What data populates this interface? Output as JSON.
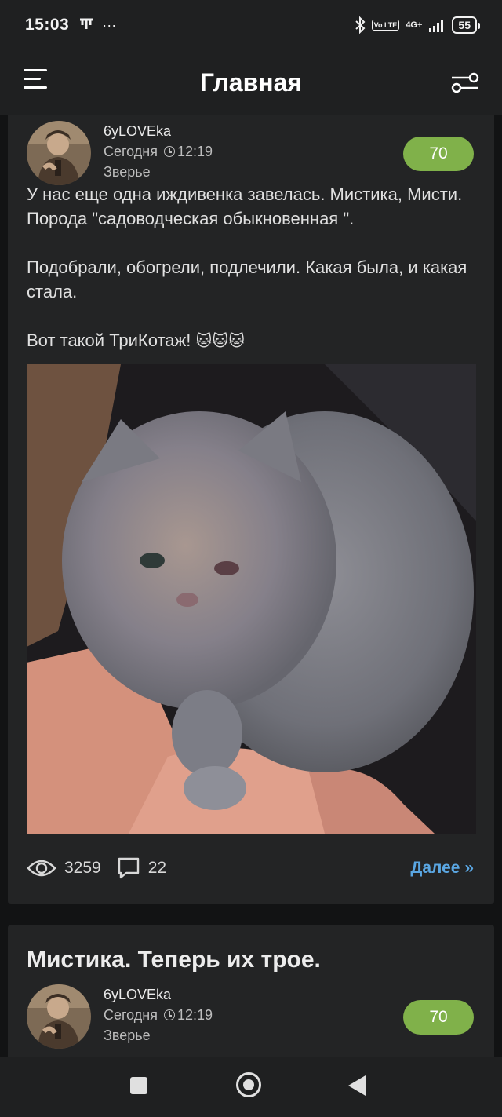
{
  "status_bar": {
    "time": "15:03",
    "extra_icons": "···",
    "network": "4G+",
    "volte": "Vo LTE",
    "battery": "55"
  },
  "app_bar": {
    "title": "Главная"
  },
  "posts": [
    {
      "author": "6yLOVEka",
      "date_prefix": "Сегодня",
      "time": "12:19",
      "category": "Зверье",
      "rating": "70",
      "paragraphs": [
        "У нас еще одна иждивенка завелась. Мистика, Мисти. Порода \"садоводческая обыкновенная \".",
        "Подобрали, обогрели, подлечили. Какая была, и какая стала.",
        "Вот такой ТриКотаж!"
      ],
      "emoji": "🐱🐱🐱",
      "views": "3259",
      "comments": "22",
      "more_label": "Далее »"
    },
    {
      "title": "Мистика. Теперь их трое.",
      "author": "6yLOVEka",
      "date_prefix": "Сегодня",
      "time": "12:19",
      "category": "Зверье",
      "rating": "70"
    }
  ],
  "colors": {
    "background": "#121314",
    "card": "#232425",
    "rating": "#80b14a",
    "link": "#5aa6e2"
  }
}
